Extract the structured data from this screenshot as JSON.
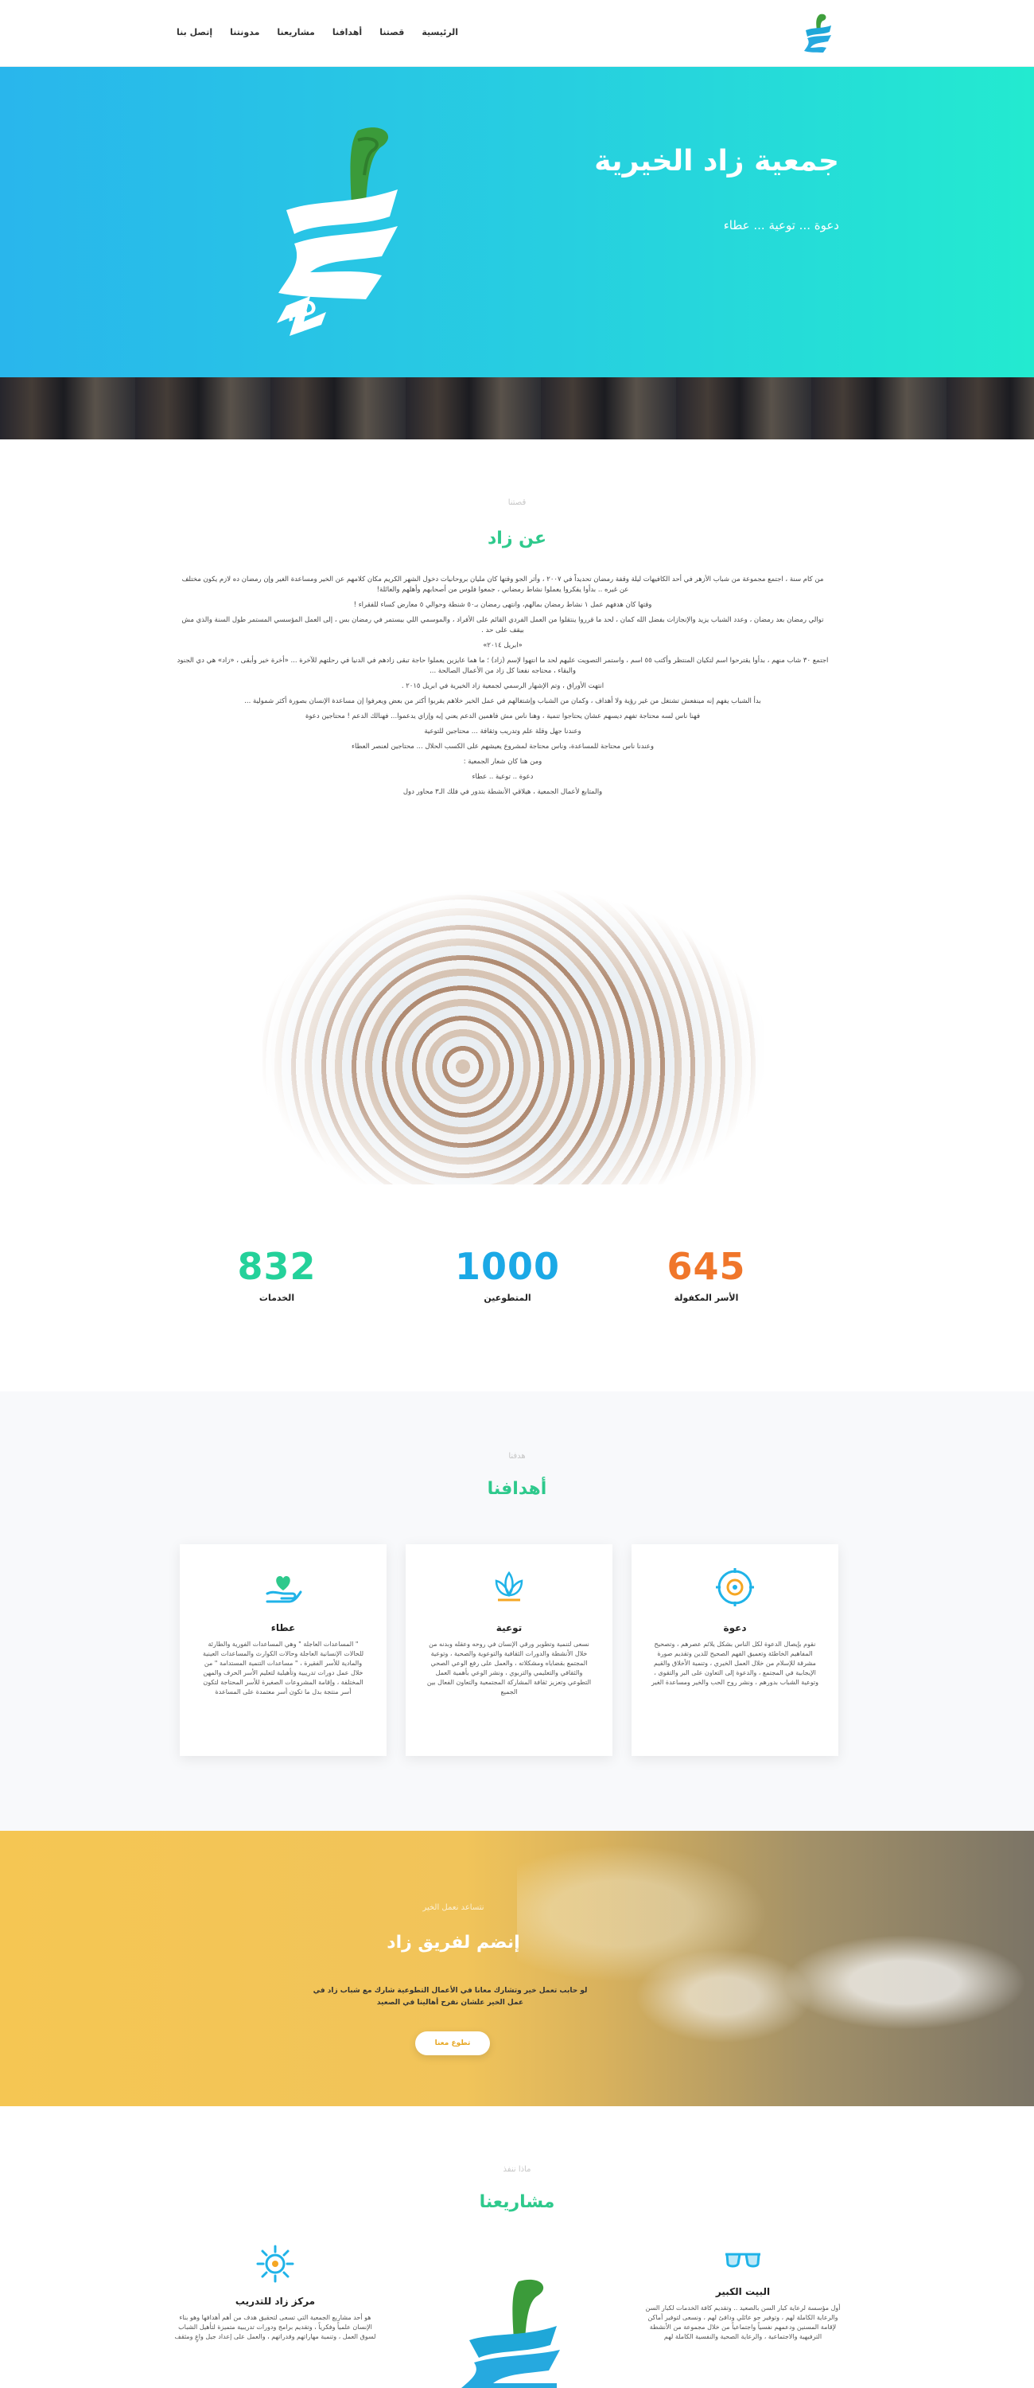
{
  "header": {
    "nav": [
      "الرئيسية",
      "قصتنا",
      "أهدافنا",
      "مشاريعنا",
      "مدونتنا",
      "إتصل بنا"
    ]
  },
  "hero": {
    "title": "جمعية زاد الخيرية",
    "subtitle": "دعوة ... توعية ... عطاء"
  },
  "about": {
    "kicker": "قصتنا",
    "title": "عن زاد",
    "paragraphs": [
      "من كام سنة ، اجتمع مجموعة من شباب الأزهر في أحد الكافيهات ليلة وقفة رمضان تحديداً في ٢٠٠٧ ، وأثر الجو وقتها كان مليان بروحانيات دخول الشهر الكريم مكان كلامهم عن الخير ومساعدة الغير وإن رمضان ده لازم يكون مختلف عن غيره .. بدأوا يفكروا يعملوا نشاط رمضاني ، جمعوا فلوس من أصحابهم وأهلهم والعائلة!",
      "وقتها كان هدفهم عمل ١ نشاط رمضان بمالهم، وانتهى رمضان بـ٥٠ شنطة وحوالي ٥ معارض كساء للفقراء !",
      "توالي رمضان بعد رمضان ، وعدد الشباب يزيد والإنجازات بفضل الله كمان ، لحد ما قرروا ينتقلوا من العمل الفردي القائم على الأفراد ، والموسمي اللي بيستمر في رمضان بس ، إلى العمل المؤسسي المستمر طول السنة والذي مش بيقف على حد .",
      "«ابريل ٢٠١٤»",
      "اجتمع ٣٠ شاب منهم ، بدأوا يقترحوا اسم لتكيان المنتظر وأكتب ٥٥ اسم ، واستمر التصويت عليهم لحد ما انتهوا لإسم (زاد) ؛ ما هما عايزين يعملوا حاجة تبقى زادهم في الدنيا في رحلتهم للآخرة ... «أخرة خير وأبقى ، «زاد» هي دي الجنود والبقاء ، محتاجه نفعنا كل زاد من الأعمال الصالحة ...",
      "انتهت الأوراق ، وتم الإشهار الرسمي لجمعية زاد الخيرية في ابريل ٢٠١٥ .",
      "بدأ الشباب يفهم إنه مينفعش تشتغل من غير رؤية ولا أهداف ، وكمان من الشباب وإشتغالهم في عمل الخير خلاهم يقربوا أكتر من بعض ويعرفوا إن مساعدة الإنسان بصورة أكثر شمولية ...",
      "فهنا ناس لسه محتاجة تفهم ديسهم عشان يحتاجوا تنمية ، وهنا ناس مش فاهمين الدعم يعني إيه وإزاي يدعموا... فهنالك الدعم ! محتاجين دعوة",
      "وعندنا جهل وقلة علم وتدريب وثقافة ... محتاجين للتوعية",
      "وعندنا ناس محتاجة للمساعدة، وناس محتاجة لمشروع يعيشهم على الكسب الحلال ... محتاجين لعنصر العطاء",
      "ومن هنا كان شعار الجمعية :",
      "دعوة .. توعية .. عطاء",
      "والمتابع لأعمال الجمعية ، هيلاقي الأنشطة بتدور في فلك الـ٣ محاور دول"
    ]
  },
  "stats": [
    {
      "value": "645",
      "label": "الأسر المكفولة",
      "color": "#f0762a"
    },
    {
      "value": "1000",
      "label": "المتطوعين",
      "color": "#1ba9e6"
    },
    {
      "value": "832",
      "label": "الخدمات",
      "color": "#24d19a"
    }
  ],
  "goals": {
    "kicker": "هدفنا",
    "title": "أهدافنا",
    "cards": [
      {
        "title": "دعوة",
        "icon": "dharma-wheel-icon",
        "text": "نقوم بإيصال الدعوة لكل الناس بشكل يلائم عصرهم ، وتصحيح المفاهيم الخاطئة وتعميق الفهم الصحيح للدين وتقديم صورة مشرقة للإسلام من خلال العمل الخيري ، وتنمية الأخلاق والقيم الإيجابية في المجتمع ، والدعوة إلى التعاون على البر والتقوى ، وتوعية الشباب بدورهم ، ونشر روح الحب والخير ومساعدة الغير"
      },
      {
        "title": "توعية",
        "icon": "lotus-icon",
        "text": "نسعى لتنمية وتطوير ورقي الإنسان في روحه وعقله وبدنه من خلال الأنشطة والدورات الثقافية والتوعوية والصحية ، وتوعية المجتمع بقضاياه ومشكلاته ، والعمل على رفع الوعي الصحي والثقافي والتعليمي والتربوي ، ونشر الوعي بأهمية العمل التطوعي وتعزيز ثقافة المشاركة المجتمعية والتعاون الفعال بين الجميع"
      },
      {
        "title": "عطاء",
        "icon": "giving-hand-icon",
        "text": "\" المساعدات العاجلة \" وهي المساعدات الفورية والطارئة للحالات الإنسانية العاجلة وحالات الكوارث والمساعدات العينية والمادية للأسر الفقيرة ، \" مساعدات التنمية المستدامة \" من خلال عمل دورات تدريبية وتأهيلية لتعليم الأسر الحرف والمهن المختلفة ، وإقامة المشروعات الصغيرة للأسر المحتاجة لتكون أسر منتجة بدل ما تكون أسر معتمدة على المساعدة"
      }
    ]
  },
  "join": {
    "kicker": "نتساعد نعمل الخير",
    "title": "إنضم لفريق زاد",
    "text": "لو حابب تعمل خير وتشارك معانا في الأعمال التطوعية شارك مع شباب زاد في عمل الخير علشان نفرح أهالينا في الصعيد",
    "button": "تطوع معنا"
  },
  "projects": {
    "kicker": "ماذا ننفذ",
    "title": "مشاريعنا",
    "items": [
      {
        "title": "البيت الكبير",
        "icon": "glasses-icon",
        "text": "أول مؤسسة لرعاية كبار السن بالصعيد .. وتقديم كافة الخدمات لكبار السن والرعاية الكاملة لهم ، وتوفير جو عائلي ودافئ لهم ، ونسعى لتوفير أماكن لإقامة المسنين ودعمهم نفسياً واجتماعياً من خلال مجموعة من الأنشطة الترفيهية والاجتماعية ، والرعاية الصحية والنفسية الكاملة لهم"
      },
      {
        "title": "مركز زاد للتدريب",
        "icon": "sun-gear-icon",
        "text": "هو أحد مشاريع الجمعية التي تسعى لتحقيق هدف من أهم أهدافها وهو بناء الإنسان علمياً وفكرياً ، وتقديم برامج ودورات تدريبية متميزة لتأهيل الشباب لسوق العمل ، وتنمية مهاراتهم وقدراتهم ، والعمل على إعداد جيل واعٍ ومثقف"
      }
    ]
  },
  "colors": {
    "accent_green": "#2ec98c",
    "hero_left": "#29b6ec",
    "hero_right": "#23ead0",
    "join_yellow": "#f5c653"
  }
}
